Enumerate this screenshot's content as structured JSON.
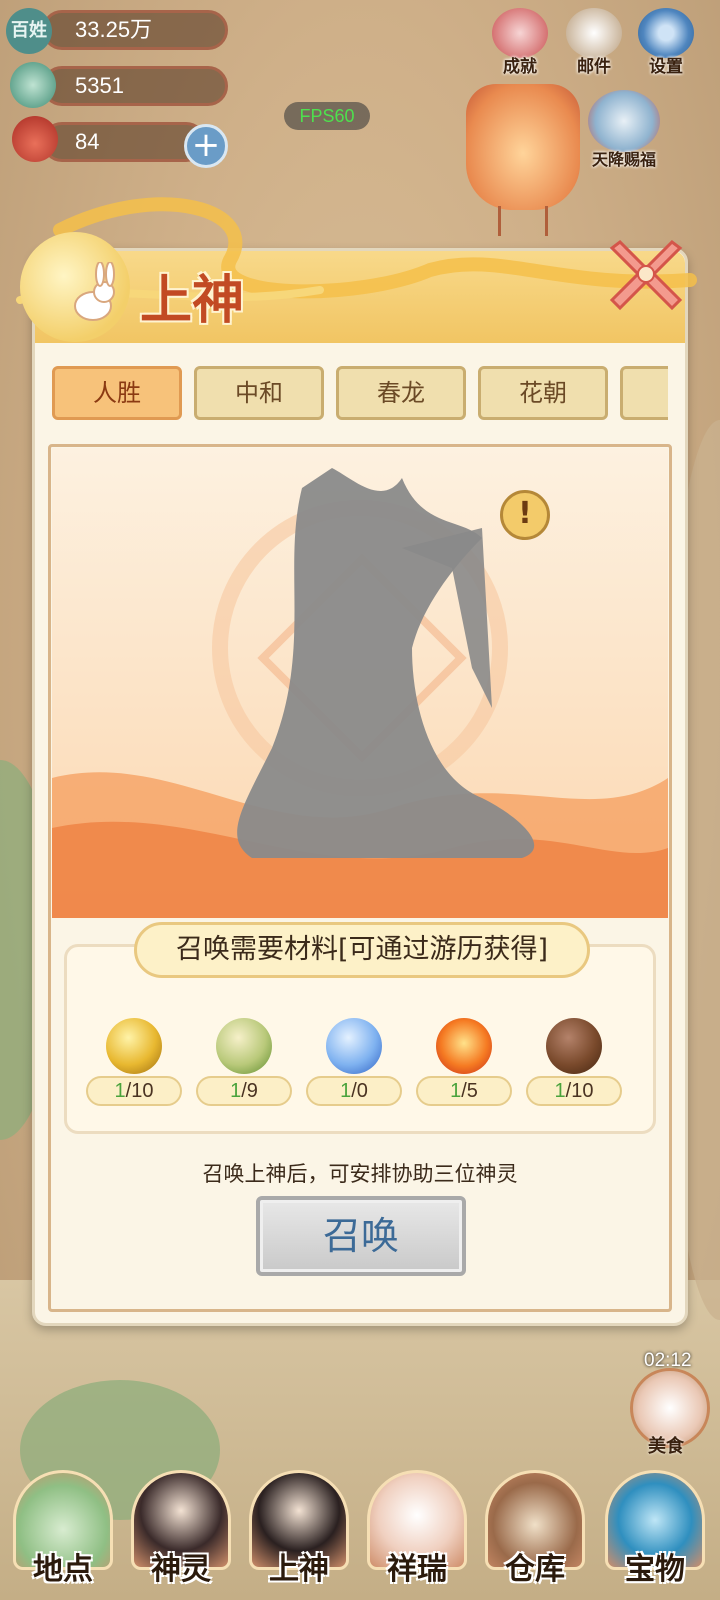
{
  "resources": [
    {
      "icon": "baixing-icon",
      "icon_text": "百姓",
      "value": "33.25万"
    },
    {
      "icon": "jade-icon",
      "value": "5351"
    },
    {
      "icon": "money-bag-icon",
      "value": "84"
    }
  ],
  "fps": "FPS60",
  "top_buttons": [
    {
      "label": "成就",
      "icon": "achievement-scroll-icon"
    },
    {
      "label": "邮件",
      "icon": "mail-icon"
    },
    {
      "label": "设置",
      "icon": "gear-icon"
    }
  ],
  "event_button": {
    "label": "天降赐福",
    "icon": "cloud-blessing-icon"
  },
  "modal": {
    "title": "上神",
    "tabs": [
      "人胜",
      "中和",
      "春龙",
      "花朝",
      ""
    ],
    "active_tab": "人胜",
    "materials_title": "召唤需要材料[可通过游历获得]",
    "materials": [
      {
        "icon": "gold-orb-icon",
        "have": "1",
        "need": "/10",
        "color": "#e8b830"
      },
      {
        "icon": "wood-orb-icon",
        "have": "1",
        "need": "/9",
        "color": "#8fbf4a"
      },
      {
        "icon": "water-orb-icon",
        "have": "1",
        "need": "/0",
        "color": "#5a9be8"
      },
      {
        "icon": "fire-orb-icon",
        "have": "1",
        "need": "/5",
        "color": "#f06a22"
      },
      {
        "icon": "earth-orb-icon",
        "have": "1",
        "need": "/10",
        "color": "#7a4a2c"
      }
    ],
    "hint": "召唤上神后，可安排协助三位神灵",
    "summon_label": "召唤"
  },
  "timer": "02:12",
  "food": {
    "label": "美食",
    "icon": "tangyuan-bowl-icon"
  },
  "nav": [
    {
      "label": "地点",
      "icon": "mountain-icon"
    },
    {
      "label": "神灵",
      "icon": "deity-portrait-icon"
    },
    {
      "label": "上神",
      "icon": "shangshen-portrait-icon"
    },
    {
      "label": "祥瑞",
      "icon": "auspicious-beast-icon"
    },
    {
      "label": "仓库",
      "icon": "warehouse-icon"
    },
    {
      "label": "宝物",
      "icon": "treasure-gourd-icon"
    }
  ]
}
